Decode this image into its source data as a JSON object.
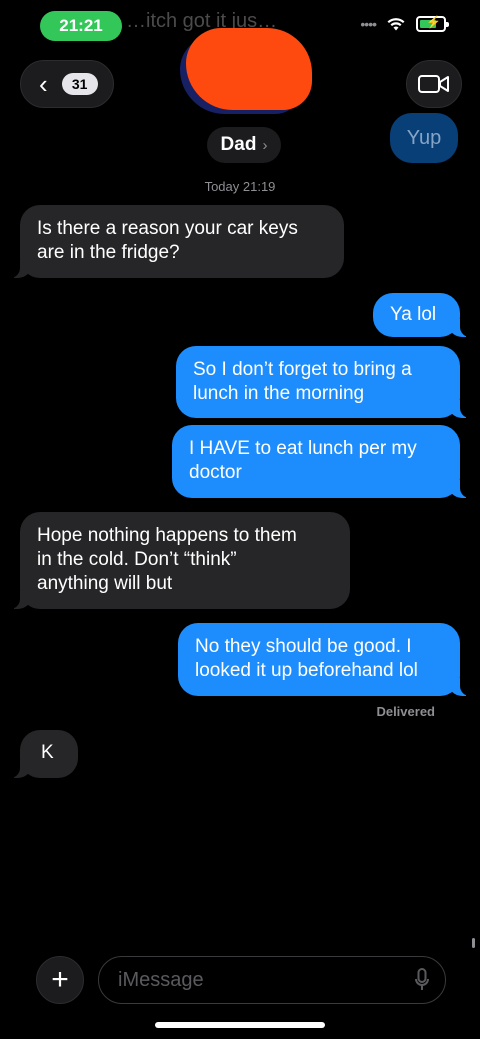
{
  "status_bar": {
    "time": "21:21",
    "behind_text": "…itch got it jus…"
  },
  "nav": {
    "back_count": "31"
  },
  "contact": {
    "name": "Dad"
  },
  "overlay_bubble": {
    "text": "Yup"
  },
  "timestamp": "Today 21:19",
  "messages": [
    {
      "dir": "received",
      "text": "Is there a reason your car keys\nare in the fridge?"
    },
    {
      "dir": "sent",
      "text": "Ya lol"
    },
    {
      "dir": "sent",
      "text": "So I don’t forget to bring a\nlunch in the morning"
    },
    {
      "dir": "sent",
      "text": "I HAVE to eat lunch per my\ndoctor"
    },
    {
      "dir": "received",
      "text": "Hope nothing happens to them\nin the cold.   Don’t “think”\nanything will but"
    },
    {
      "dir": "sent",
      "text": "No they should be good. I\nlooked it up beforehand lol"
    },
    {
      "dir": "received",
      "text": "K"
    }
  ],
  "delivered_label": "Delivered",
  "composer": {
    "placeholder": "iMessage"
  },
  "colors": {
    "sent": "#1d8dfd",
    "received": "#262628",
    "status_green": "#33c759",
    "redaction": "#ff4a0f"
  },
  "icons": [
    "back-chevron-icon",
    "video-camera-icon",
    "wifi-icon",
    "battery-charging-icon",
    "plus-icon",
    "microphone-icon"
  ]
}
